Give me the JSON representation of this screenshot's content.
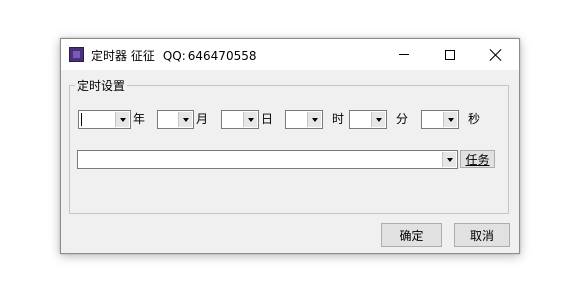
{
  "window": {
    "title": "定时器 征征",
    "title_qq_label": "QQ:",
    "title_qq_number": "646470558"
  },
  "controls": {
    "minimize": "minimize",
    "maximize": "maximize",
    "close": "close"
  },
  "group": {
    "label": "定时设置",
    "date_units": {
      "year": "年",
      "month": "月",
      "day": "日",
      "hour": "时",
      "minute": "分",
      "second": "秒"
    },
    "task_button": "任务"
  },
  "buttons": {
    "ok": "确定",
    "cancel": "取消"
  },
  "icons": [
    "app-icon",
    "minimize-icon",
    "maximize-icon",
    "close-icon",
    "dropdown-arrow-icon"
  ],
  "colors": {
    "titlebar": "#ffffff",
    "window_bg": "#f0f0f0",
    "app_icon": "#4a2f7a"
  }
}
